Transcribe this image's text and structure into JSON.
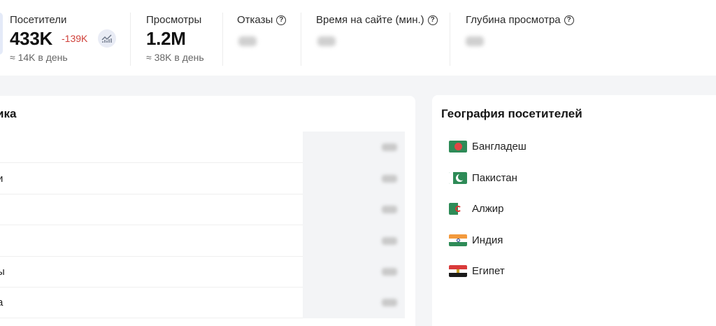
{
  "stats": {
    "visitors": {
      "label": "Посетители",
      "value": "433K",
      "delta": "-139K",
      "per_day": "≈ 14K в день"
    },
    "views": {
      "label": "Просмотры",
      "value": "1.2M",
      "per_day": "≈ 38K в день"
    },
    "bounces": {
      "label": "Отказы"
    },
    "time_on_site": {
      "label": "Время на сайте (мин.)"
    },
    "view_depth": {
      "label": "Глубина просмотра"
    }
  },
  "traffic_sources": {
    "title_fragment": "ика",
    "rows": [
      {
        "label": ""
      },
      {
        "label": "и"
      },
      {
        "label": ""
      },
      {
        "label": ""
      },
      {
        "label": "ы"
      },
      {
        "label": "а"
      }
    ]
  },
  "geography": {
    "title": "География посетителей",
    "countries": [
      {
        "name": "Бангладеш",
        "flag": "bangladesh-flag"
      },
      {
        "name": "Пакистан",
        "flag": "pakistan-flag"
      },
      {
        "name": "Алжир",
        "flag": "algeria-flag"
      },
      {
        "name": "Индия",
        "flag": "india-flag"
      },
      {
        "name": "Египет",
        "flag": "egypt-flag"
      }
    ]
  },
  "colors": {
    "delta_negative": "#d0413a",
    "accent": "#e9ecf5"
  }
}
